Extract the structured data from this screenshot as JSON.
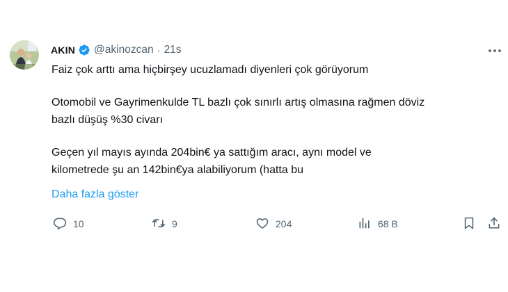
{
  "author": {
    "name": "AKIN",
    "handle": "@akinozcan",
    "separator": "·",
    "time": "21s"
  },
  "body": {
    "line1": "Faiz çok arttı ama hiçbirşey ucuzlamadı diyenleri çok görüyorum",
    "line2": "Otomobil ve Gayrimenkulde TL bazlı çok sınırlı artış olmasına rağmen döviz",
    "line3": "bazlı düşüş %30 civarı",
    "line4": "Geçen yıl mayıs ayında 204bin€ ya sattığım aracı, aynı model ve",
    "line5": "kilometrede şu an 142bin€ya alabiliyorum (hatta bu",
    "show_more": "Daha fazla göster"
  },
  "actions": {
    "replies": "10",
    "reposts": "9",
    "likes": "204",
    "views": "68 B"
  },
  "colors": {
    "text": "#0f1419",
    "muted": "#536471",
    "accent": "#1d9bf0"
  },
  "icons": [
    "verified-badge-icon",
    "more-icon",
    "reply-icon",
    "repost-icon",
    "like-icon",
    "views-icon",
    "bookmark-icon",
    "share-icon"
  ]
}
